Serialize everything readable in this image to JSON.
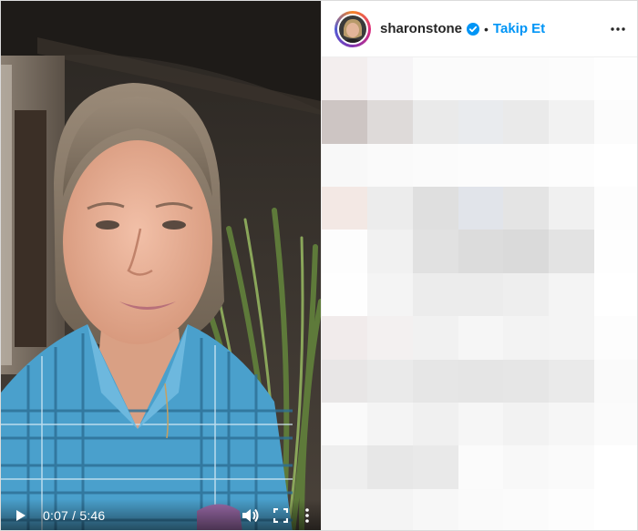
{
  "video": {
    "current_time": "0:07",
    "duration": "5:46",
    "time_separator": " / "
  },
  "post": {
    "username": "sharonstone",
    "separator": "•",
    "follow_label": "Takip Et"
  },
  "icons": {
    "play": "play-icon",
    "volume": "volume-icon",
    "fullscreen": "fullscreen-icon",
    "more_vertical": "more-vertical-icon",
    "verified": "verified-badge-icon",
    "more_horizontal": "more-horizontal-icon"
  },
  "colors": {
    "follow_blue": "#0095f6",
    "verified_blue": "#0095f6",
    "username_text": "#262626"
  },
  "blurred_tiles": [
    [
      "#f3eeee",
      "#f6f4f6",
      "#fbfbfb",
      "#fbfbfb",
      "#fbfbfb",
      "#fcfcfc",
      "#fefefe"
    ],
    [
      "#cdc5c3",
      "#dedad9",
      "#eaeaea",
      "#e9ebee",
      "#eaeaea",
      "#f2f2f2",
      "#fcfcfc"
    ],
    [
      "#f8f8f8",
      "#fafafa",
      "#fbfbfb",
      "#fcfcfc",
      "#fcfcfc",
      "#fdfdfd",
      "#ffffff"
    ],
    [
      "#f3e8e4",
      "#ececec",
      "#dfdfdf",
      "#e1e4ea",
      "#e4e4e4",
      "#f0f0f0",
      "#fdfdfd"
    ],
    [
      "#fdfdfd",
      "#f1f1f1",
      "#e1e1e1",
      "#dcdcdc",
      "#dadada",
      "#e3e3e3",
      "#fefefe"
    ],
    [
      "#fefefe",
      "#f4f4f4",
      "#ececec",
      "#ececec",
      "#eeeeee",
      "#f4f4f4",
      "#ffffff"
    ],
    [
      "#f1ebeb",
      "#f3f0f0",
      "#f1f1f1",
      "#f6f6f6",
      "#f3f3f3",
      "#f4f4f4",
      "#fdfdfd"
    ],
    [
      "#e8e6e6",
      "#eaeaea",
      "#e6e6e6",
      "#e5e5e5",
      "#e6e6e6",
      "#eaeaea",
      "#fafafa"
    ],
    [
      "#fafafa",
      "#f4f4f4",
      "#f0f0f0",
      "#f6f6f6",
      "#f2f2f2",
      "#f6f6f6",
      "#fbfbfb"
    ],
    [
      "#eeeeee",
      "#e7e7e7",
      "#e9e9e9",
      "#fbfbfb",
      "#f8f8f8",
      "#fafafa",
      "#ffffff"
    ],
    [
      "#f4f4f4",
      "#f4f4f4",
      "#f7f7f7",
      "#fafafa",
      "#fbfbfb",
      "#fdfdfd",
      "#ffffff"
    ]
  ]
}
